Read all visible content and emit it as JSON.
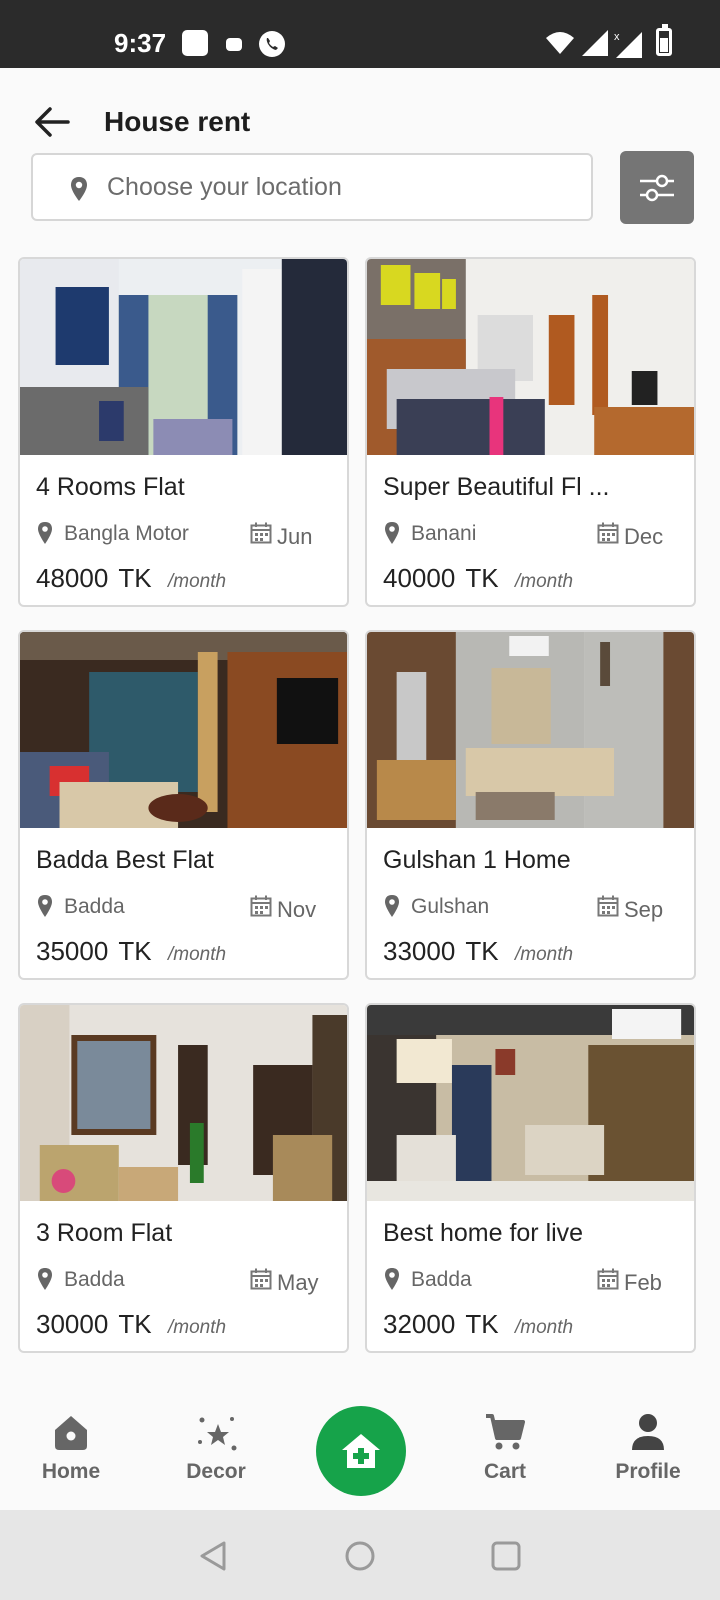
{
  "status_bar": {
    "time": "9:37"
  },
  "header": {
    "title": "House rent"
  },
  "search": {
    "placeholder": "Choose your location",
    "value": ""
  },
  "listings": [
    {
      "title": "4 Rooms Flat",
      "location": "Bangla Motor",
      "month": "Jun",
      "price": "48000",
      "currency": "TK",
      "period": "/month"
    },
    {
      "title": "Super Beautiful Fl ...",
      "location": "Banani",
      "month": "Dec",
      "price": "40000",
      "currency": "TK",
      "period": "/month"
    },
    {
      "title": "Badda Best Flat",
      "location": "Badda",
      "month": "Nov",
      "price": "35000",
      "currency": "TK",
      "period": "/month"
    },
    {
      "title": "Gulshan 1 Home",
      "location": "Gulshan",
      "month": "Sep",
      "price": "33000",
      "currency": "TK",
      "period": "/month"
    },
    {
      "title": "3 Room Flat",
      "location": "Badda",
      "month": "May",
      "price": "30000",
      "currency": "TK",
      "period": "/month"
    },
    {
      "title": "Best home for live",
      "location": "Badda",
      "month": "Feb",
      "price": "32000",
      "currency": "TK",
      "period": "/month"
    }
  ],
  "bottom_nav": {
    "home": "Home",
    "decor": "Decor",
    "add_icon": "add-home-icon",
    "cart": "Cart",
    "profile": "Profile"
  },
  "colors": {
    "accent": "#16a34a",
    "filter_button": "#757575",
    "status_bar": "#2b2b2b"
  }
}
